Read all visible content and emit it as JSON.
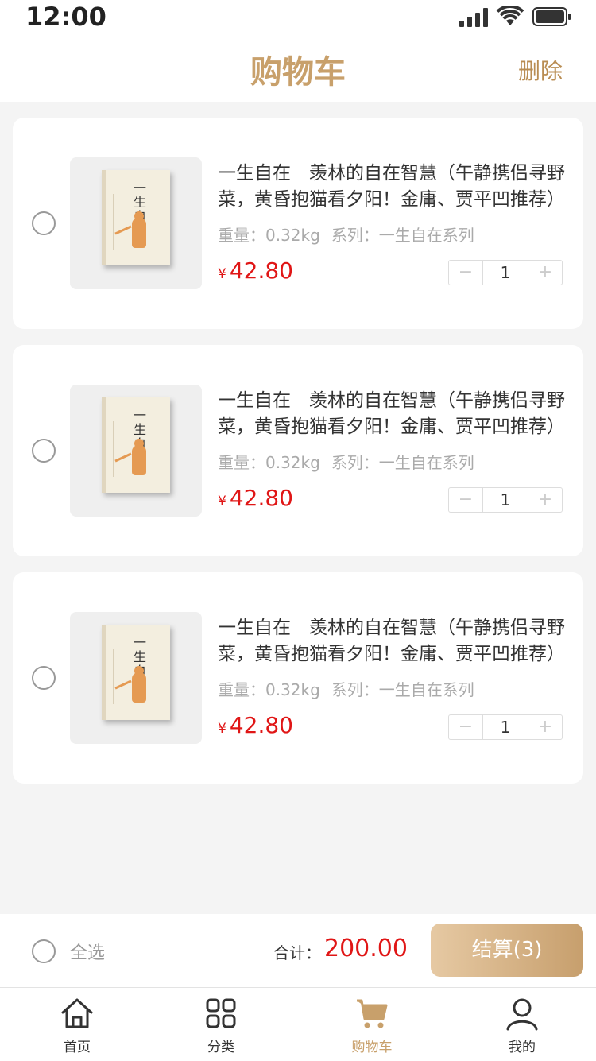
{
  "status_bar": {
    "time": "12:00"
  },
  "header": {
    "title": "购物车",
    "action": "删除"
  },
  "cart_items": [
    {
      "title": "一生自在　羡林的自在智慧（午静携侣寻野菜，黄昏抱猫看夕阳！金庸、贾平凹推荐）",
      "weight_label": "重量：0.32kg",
      "series_label": "系列：一生自在系列",
      "currency": "¥",
      "price": "42.80",
      "quantity": "1",
      "minus": "−",
      "plus": "+"
    },
    {
      "title": "一生自在　羡林的自在智慧（午静携侣寻野菜，黄昏抱猫看夕阳！金庸、贾平凹推荐）",
      "weight_label": "重量：0.32kg",
      "series_label": "系列：一生自在系列",
      "currency": "¥",
      "price": "42.80",
      "quantity": "1",
      "minus": "−",
      "plus": "+"
    },
    {
      "title": "一生自在　羡林的自在智慧（午静携侣寻野菜，黄昏抱猫看夕阳！金庸、贾平凹推荐）",
      "weight_label": "重量：0.32kg",
      "series_label": "系列：一生自在系列",
      "currency": "¥",
      "price": "42.80",
      "quantity": "1",
      "minus": "−",
      "plus": "+"
    }
  ],
  "book_cover": {
    "title_text": "一生自在"
  },
  "footer": {
    "select_all": "全选",
    "total_label": "合计：",
    "total_value": "200.00",
    "checkout": "结算(3)"
  },
  "tabs": [
    {
      "label": "首页",
      "icon": "home-icon"
    },
    {
      "label": "分类",
      "icon": "category-icon"
    },
    {
      "label": "购物车",
      "icon": "cart-icon",
      "active": true
    },
    {
      "label": "我的",
      "icon": "user-icon"
    }
  ],
  "colors": {
    "accent": "#c8a06b",
    "price": "#e01616",
    "background": "#f4f4f4"
  }
}
